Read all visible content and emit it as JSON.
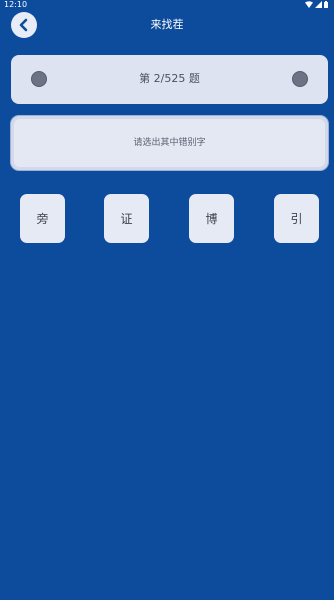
{
  "status_bar": {
    "time": "12:10",
    "icons": [
      "wifi-icon",
      "cell-signal-icon",
      "battery-icon"
    ]
  },
  "app_bar": {
    "title": "来找茬",
    "back_icon": "chevron-left-icon"
  },
  "progress": {
    "text": "第 2/525 题"
  },
  "prompt": {
    "text": "请选出其中错别字"
  },
  "options": [
    {
      "char": "旁"
    },
    {
      "char": "证"
    },
    {
      "char": "博"
    },
    {
      "char": "引"
    }
  ],
  "colors": {
    "background": "#0d4c9c",
    "card": "#dde3f1",
    "tile": "#e6eaf4",
    "dot": "#6b7384"
  }
}
